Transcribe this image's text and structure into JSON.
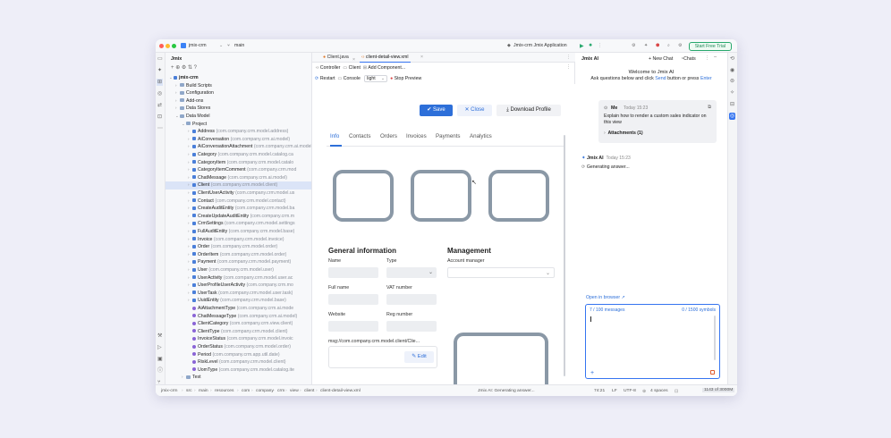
{
  "titlebar": {
    "project": "jmix-crm",
    "branch": "main",
    "run_config": "Jmix-crm Jmix Application",
    "trial_button": "Start Free Trial"
  },
  "project_panel": {
    "title": "Jmix",
    "root": "jmix-crm",
    "items": [
      {
        "label": "Build Scripts",
        "pkg": ""
      },
      {
        "label": "Configuration",
        "pkg": ""
      },
      {
        "label": "Add-ons",
        "pkg": ""
      },
      {
        "label": "Data Stores",
        "pkg": ""
      },
      {
        "label": "Data Model",
        "pkg": ""
      },
      {
        "label": "Project",
        "pkg": ""
      },
      {
        "label": "Address",
        "pkg": "(com.company.crm.model.address)"
      },
      {
        "label": "AiConversation",
        "pkg": "(com.company.crm.ai.model)"
      },
      {
        "label": "AiConversationAttachment",
        "pkg": "(com.company.crm.ai.model)"
      },
      {
        "label": "Category",
        "pkg": "(com.company.crm.model.catalog.ca"
      },
      {
        "label": "CategoryItem",
        "pkg": "(com.company.crm.model.catalo"
      },
      {
        "label": "CategoryItemComment",
        "pkg": "(com.company.crm.mod"
      },
      {
        "label": "ChatMessage",
        "pkg": "(com.company.crm.ai.model)"
      },
      {
        "label": "Client",
        "pkg": "(com.company.crm.model.client)"
      },
      {
        "label": "ClientUserActivity",
        "pkg": "(com.company.crm.model.us"
      },
      {
        "label": "Contact",
        "pkg": "(com.company.crm.model.contact)"
      },
      {
        "label": "CreateAuditEntity",
        "pkg": "(com.company.crm.model.ba"
      },
      {
        "label": "CreateUpdateAuditEntity",
        "pkg": "(com.company.crm.m"
      },
      {
        "label": "CrmSettings",
        "pkg": "(com.company.crm.model.settings"
      },
      {
        "label": "FullAuditEntity",
        "pkg": "(com.company.crm.model.base)"
      },
      {
        "label": "Invoice",
        "pkg": "(com.company.crm.model.invoice)"
      },
      {
        "label": "Order",
        "pkg": "(com.company.crm.model.order)"
      },
      {
        "label": "OrderItem",
        "pkg": "(com.company.crm.model.order)"
      },
      {
        "label": "Payment",
        "pkg": "(com.company.crm.model.payment)"
      },
      {
        "label": "User",
        "pkg": "(com.company.crm.model.user)"
      },
      {
        "label": "UserActivity",
        "pkg": "(com.company.crm.model.user.ac"
      },
      {
        "label": "UserProfileUserActivity",
        "pkg": "(com.company.crm.mo"
      },
      {
        "label": "UserTask",
        "pkg": "(com.company.crm.model.user.task)"
      },
      {
        "label": "UuidEntity",
        "pkg": "(com.company.crm.model.base)"
      },
      {
        "label": "AiAttachmentType",
        "pkg": "(com.company.crm.ai.mode"
      },
      {
        "label": "ChatMessageType",
        "pkg": "(com.company.crm.ai.model)"
      },
      {
        "label": "ClientCategory",
        "pkg": "(com.company.crm.view.client)"
      },
      {
        "label": "ClientType",
        "pkg": "(com.company.crm.model.client)"
      },
      {
        "label": "InvoiceStatus",
        "pkg": "(com.company.crm.model.invoic"
      },
      {
        "label": "OrderStatus",
        "pkg": "(com.company.crm.model.order)"
      },
      {
        "label": "Period",
        "pkg": "(com.company.crm.app.util.date)"
      },
      {
        "label": "RiskLevel",
        "pkg": "(com.company.crm.model.client)"
      },
      {
        "label": "UomType",
        "pkg": "(com.company.crm.model.catalog.ite"
      },
      {
        "label": "Test",
        "pkg": ""
      }
    ]
  },
  "editor": {
    "tabs": [
      "Client.java",
      "client-detail-view.xml"
    ],
    "toolbar1": [
      "Controller",
      "Client",
      "Add Component..."
    ],
    "toolbar2": {
      "restart": "Restart",
      "console": "Console",
      "theme": "light",
      "stop": "Stop Preview"
    },
    "buttons": {
      "save": "Save",
      "close": "Close",
      "download": "Download Profile"
    },
    "view_tabs": [
      "Info",
      "Contacts",
      "Orders",
      "Invoices",
      "Payments",
      "Analytics"
    ],
    "general_title": "General information",
    "management_title": "Management",
    "labels": {
      "name": "Name",
      "type": "Type",
      "full_name": "Full name",
      "vat": "VAT number",
      "website": "Website",
      "reg": "Reg number",
      "account_manager": "Account manager",
      "msg": "msg://com.company.crm.model.client/Clie..."
    },
    "edit_button": "Edit"
  },
  "ai_panel": {
    "title": "Jmix AI",
    "new_chat": "New Chat",
    "chats": "Chats",
    "welcome_title": "Welcome to Jmix AI",
    "welcome_line_pre": "Ask questions below and click",
    "welcome_send": "Send",
    "welcome_mid": "button or press",
    "welcome_enter": "Enter",
    "user_name": "Me",
    "user_time": "Today 15:23",
    "user_message": "Explain how to render a custom sales indicator on this view",
    "attachments": "Attachments (1)",
    "bot_name": "Jmix AI",
    "bot_time": "Today 15:23",
    "bot_message": "Generating answer...",
    "open_browser": "Open in browser ↗",
    "messages_count": "7 / 100 messages",
    "symbols_count": "0 / 1500 symbols"
  },
  "statusbar": {
    "path": [
      "jmix-crm",
      "src",
      "main",
      "resources",
      "com",
      "company",
      "crm",
      "view",
      "client",
      "client-detail-view.xml"
    ],
    "task": "Jmix AI: Generating answer...",
    "position": "74:21",
    "line_sep": "LF",
    "encoding": "UTF-8",
    "indent": "4 spaces",
    "memory": "1143 of 3000M"
  },
  "colors": {
    "accent": "#2d6fd9",
    "placeholder_stroke": "#8a98a6",
    "trial": "#28a86d"
  }
}
